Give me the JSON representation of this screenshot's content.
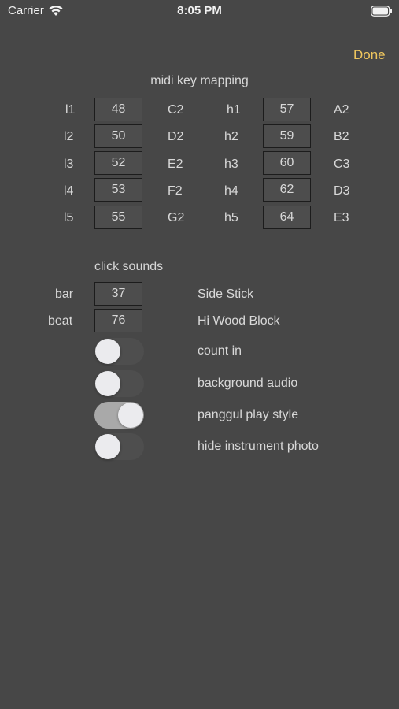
{
  "status_bar": {
    "carrier": "Carrier",
    "time": "8:05 PM",
    "wifi_icon": "wifi-icon",
    "battery_icon": "battery-icon"
  },
  "nav": {
    "done_label": "Done",
    "accent_color": "#f0c75e"
  },
  "midi": {
    "title": "midi key mapping",
    "left": [
      {
        "label": "l1",
        "value": "48",
        "note": "C2"
      },
      {
        "label": "l2",
        "value": "50",
        "note": "D2"
      },
      {
        "label": "l3",
        "value": "52",
        "note": "E2"
      },
      {
        "label": "l4",
        "value": "53",
        "note": "F2"
      },
      {
        "label": "l5",
        "value": "55",
        "note": "G2"
      }
    ],
    "right": [
      {
        "label": "h1",
        "value": "57",
        "note": "A2"
      },
      {
        "label": "h2",
        "value": "59",
        "note": "B2"
      },
      {
        "label": "h3",
        "value": "60",
        "note": "C3"
      },
      {
        "label": "h4",
        "value": "62",
        "note": "D3"
      },
      {
        "label": "h5",
        "value": "64",
        "note": "E3"
      }
    ]
  },
  "click": {
    "title": "click sounds",
    "rows": [
      {
        "label": "bar",
        "value": "37",
        "sound": "Side Stick"
      },
      {
        "label": "beat",
        "value": "76",
        "sound": "Hi Wood Block"
      }
    ]
  },
  "toggles": [
    {
      "label": "count in",
      "on": false
    },
    {
      "label": "background audio",
      "on": false
    },
    {
      "label": "panggul play style",
      "on": true
    },
    {
      "label": "hide instrument photo",
      "on": false
    }
  ]
}
